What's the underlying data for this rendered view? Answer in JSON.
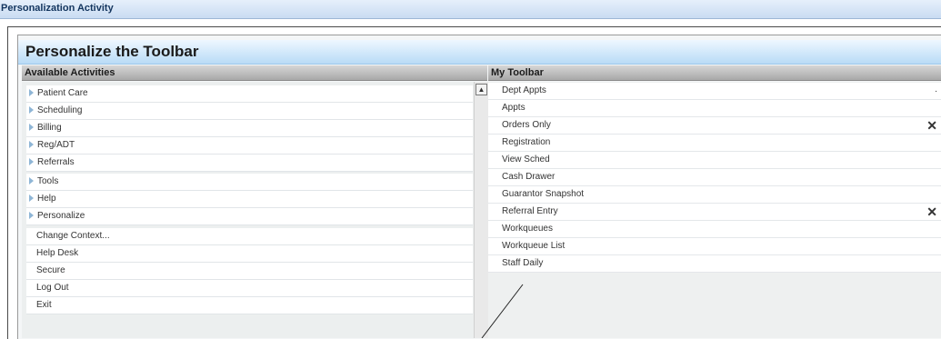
{
  "window": {
    "title": "Personalization Activity"
  },
  "header": {
    "title": "Personalize the Toolbar"
  },
  "left": {
    "heading": "Available Activities",
    "groups": [
      [
        "Patient Care",
        "Scheduling",
        "Billing",
        "Reg/ADT",
        "Referrals"
      ],
      [
        "Tools",
        "Help",
        "Personalize"
      ],
      [
        "Change Context...",
        "Help Desk",
        "Secure",
        "Log Out",
        "Exit"
      ]
    ]
  },
  "right": {
    "heading": "My Toolbar",
    "items": [
      "Dept Appts",
      "Appts",
      "Orders Only",
      "Registration",
      "View Sched",
      "Cash Drawer",
      "Guarantor Snapshot",
      "Referral Entry",
      "Workqueues",
      "Workqueue List",
      "Staff Daily"
    ],
    "remove_symbol": "✕"
  },
  "icons": {
    "expand": "triangle-right-icon",
    "scroll_up": "scroll-up-arrow-icon",
    "remove": "close-icon"
  }
}
